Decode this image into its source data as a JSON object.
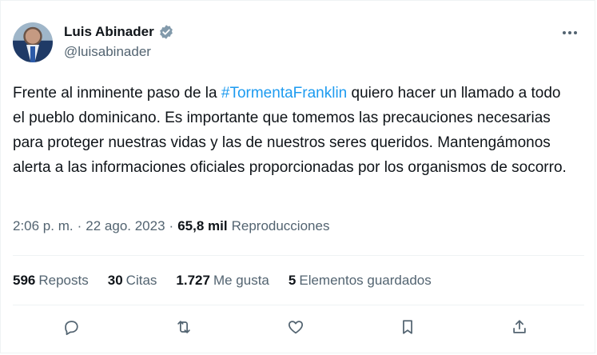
{
  "author": {
    "name": "Luis Abinader",
    "handle": "@luisabinader",
    "verified_icon": "verified-badge-icon",
    "badge_color": "#829aab"
  },
  "tweet": {
    "text_before": "Frente al inminente paso de la ",
    "hashtag": "#TormentaFranklin",
    "text_after": " quiero hacer un llamado a todo el pueblo dominicano. Es importante que tomemos las precauciones necesarias para proteger nuestras vidas y las de nuestros seres queridos. Mantengámonos alerta a las informaciones oficiales proporcionadas por los organismos de socorro.",
    "hashtag_color": "#1d9bf0"
  },
  "meta": {
    "time": "2:06 p. m.",
    "sep1": "·",
    "date": "22 ago. 2023",
    "sep2": "·",
    "views": "65,8 mil",
    "views_label": "Reproducciones"
  },
  "stats": {
    "reposts_count": "596",
    "reposts_label": "Reposts",
    "quotes_count": "30",
    "quotes_label": "Citas",
    "likes_count": "1.727",
    "likes_label": "Me gusta",
    "bookmarks_count": "5",
    "bookmarks_label": "Elementos guardados"
  },
  "actions": [
    "reply-icon",
    "repost-icon",
    "like-icon",
    "bookmark-icon",
    "share-icon"
  ]
}
